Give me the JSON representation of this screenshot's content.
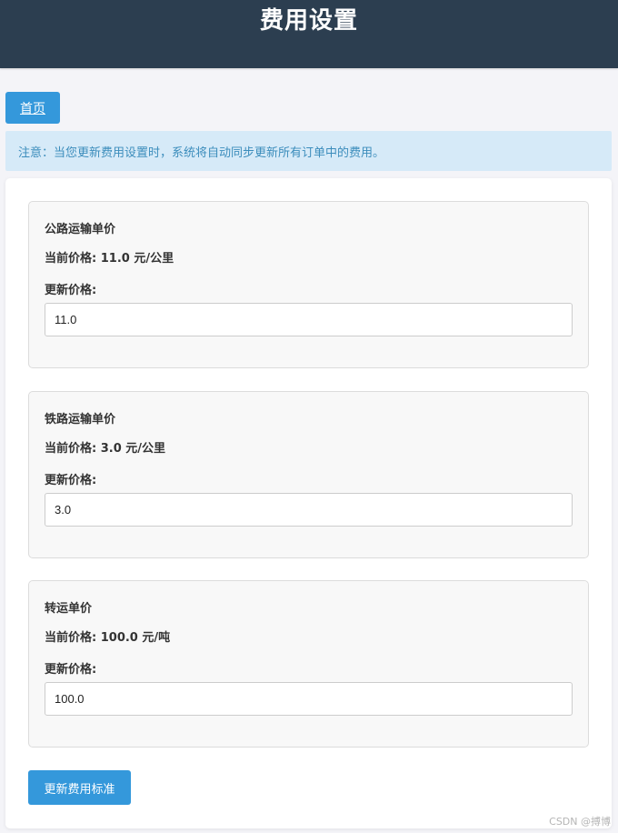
{
  "header": {
    "title": "费用设置"
  },
  "nav": {
    "home_label": "首页"
  },
  "notice": {
    "text": "注意：当您更新费用设置时，系统将自动同步更新所有订单中的费用。"
  },
  "cards": [
    {
      "title": "公路运输单价",
      "current_price": "当前价格: 11.0 元/公里",
      "update_label": "更新价格:",
      "input_value": "11.0"
    },
    {
      "title": "铁路运输单价",
      "current_price": "当前价格: 3.0 元/公里",
      "update_label": "更新价格:",
      "input_value": "3.0"
    },
    {
      "title": "转运单价",
      "current_price": "当前价格: 100.0 元/吨",
      "update_label": "更新价格:",
      "input_value": "100.0"
    }
  ],
  "submit": {
    "label": "更新费用标准"
  },
  "watermark": "CSDN @搏博",
  "colors": {
    "header_bg": "#2c3e50",
    "accent": "#3498db",
    "notice_bg": "#d6eaf8",
    "notice_text": "#3c8dbc"
  }
}
